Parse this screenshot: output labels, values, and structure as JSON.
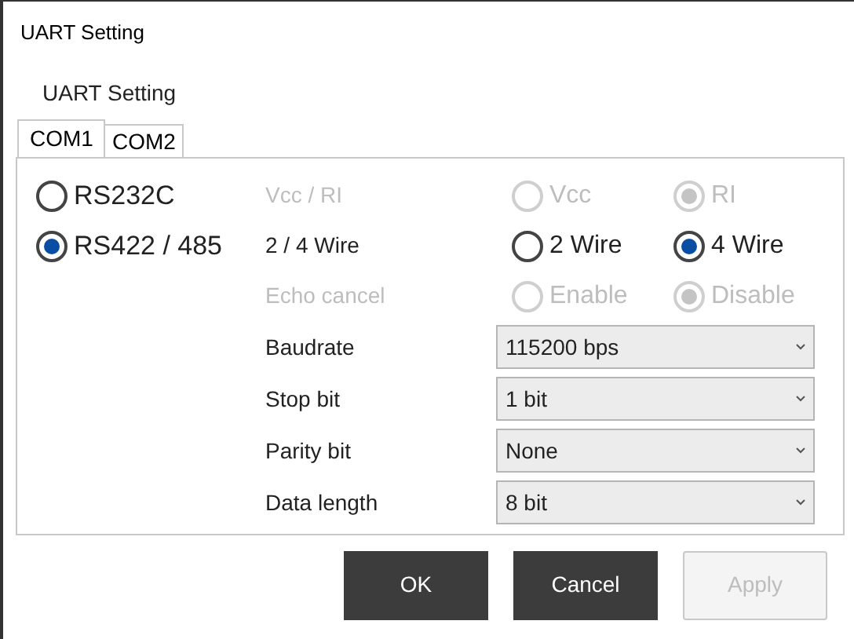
{
  "window": {
    "title": "UART Setting"
  },
  "group_label": "UART Setting",
  "tabs": [
    {
      "label": "COM1",
      "selected": true
    },
    {
      "label": "COM2",
      "selected": false
    }
  ],
  "modes": [
    {
      "label": "RS232C",
      "selected": false
    },
    {
      "label": "RS422 / 485",
      "selected": true
    }
  ],
  "settings": [
    {
      "kind": "radio",
      "label": "Vcc / RI",
      "disabled": true,
      "options": [
        {
          "label": "Vcc",
          "selected": false
        },
        {
          "label": "RI",
          "selected": true
        }
      ]
    },
    {
      "kind": "radio",
      "label": "2 / 4 Wire",
      "disabled": false,
      "options": [
        {
          "label": "2 Wire",
          "selected": false
        },
        {
          "label": "4 Wire",
          "selected": true
        }
      ]
    },
    {
      "kind": "radio",
      "label": "Echo cancel",
      "disabled": true,
      "options": [
        {
          "label": "Enable",
          "selected": false
        },
        {
          "label": "Disable",
          "selected": true
        }
      ]
    },
    {
      "kind": "select",
      "label": "Baudrate",
      "value": "115200 bps"
    },
    {
      "kind": "select",
      "label": "Stop bit",
      "value": "1 bit"
    },
    {
      "kind": "select",
      "label": "Parity bit",
      "value": "None"
    },
    {
      "kind": "select",
      "label": "Data length",
      "value": "8 bit"
    }
  ],
  "buttons": [
    {
      "label": "OK",
      "disabled": false
    },
    {
      "label": "Cancel",
      "disabled": false
    },
    {
      "label": "Apply",
      "disabled": true
    }
  ]
}
